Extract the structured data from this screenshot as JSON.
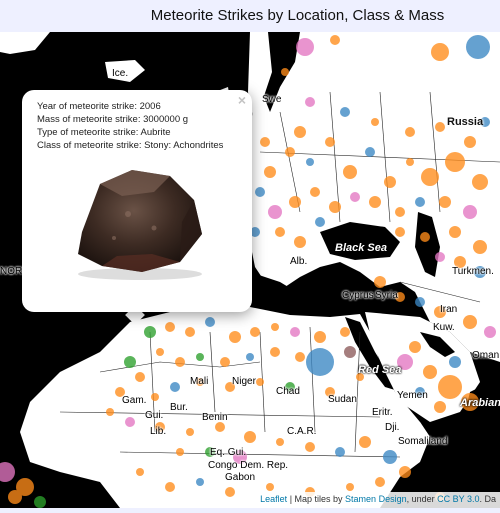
{
  "header": {
    "title": "Meteorite Strikes by Location, Class & Mass"
  },
  "popup": {
    "line1": "Year of meteorite strike: 2006",
    "line2": "Mass of meteorite strike: 3000000 g",
    "line3": "Type of meteorite strike: Aubrite",
    "line4": "Class of meteorite strike: Stony: Achondrites",
    "close_glyph": "×"
  },
  "attribution": {
    "leaflet": "Leaflet",
    "sep": " | Map tiles by ",
    "stamen": "Stamen Design",
    "under": ", under ",
    "license": "CC BY 3.0",
    "end": ". Da"
  },
  "labels": {
    "ice": "Ice.",
    "swe": "Swe",
    "russia": "Russia",
    "black_sea": "Black Sea",
    "red_sea": "Red Sea",
    "arabian": "Arabian",
    "alb": "Alb.",
    "cyprus": "Cyprus",
    "syria": "Syria",
    "iran": "Iran",
    "turkmen": "Turkmen.",
    "kuw": "Kuw.",
    "oman": "Oman",
    "yemen": "Yemen",
    "somaliland": "Somaliland",
    "eritr": "Eritr.",
    "dji": "Dji.",
    "mali": "Mali",
    "niger": "Niger",
    "chad": "Chad",
    "sudan": "Sudan",
    "gam": "Gam.",
    "gui": "Gui.",
    "bur": "Bur.",
    "benin": "Benin",
    "nigeria": "N",
    "car": "C.A.R.",
    "eq_gui": "Eq. Gui.",
    "congo": "Congo Dem. Rep.",
    "gabon": "Gabon",
    "lib": "Lib.",
    "nort": "NORT"
  },
  "legend_colors": {
    "stony_chondrites": "#ff8c1a",
    "stony_achondrites": "#e377c2",
    "iron": "#3b87c4",
    "stony_iron": "#2ca02c",
    "other": "#8c5a5a"
  }
}
